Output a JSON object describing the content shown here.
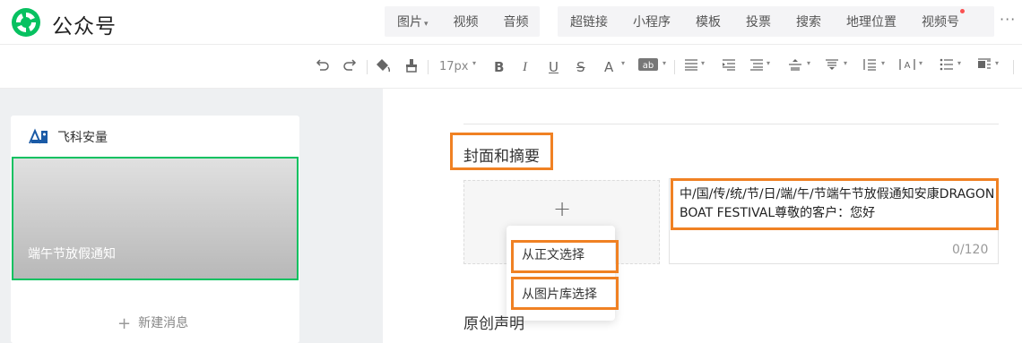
{
  "colors": {
    "brand_green": "#07c160",
    "highlight_orange": "#f08123"
  },
  "header": {
    "brand": "公众号",
    "insert_items": [
      {
        "label": "图片",
        "caret": "▾"
      },
      {
        "label": "视频"
      },
      {
        "label": "音频"
      },
      {
        "label": "超链接"
      },
      {
        "label": "小程序"
      },
      {
        "label": "模板"
      },
      {
        "label": "投票"
      },
      {
        "label": "搜索"
      },
      {
        "label": "地理位置"
      },
      {
        "label": "视频号"
      }
    ],
    "more": "···"
  },
  "toolbar": {
    "undo_icon": "undo-icon",
    "redo_icon": "redo-icon",
    "font_size": "17px",
    "bold": "B",
    "italic": "I",
    "underline": "U",
    "strike": "S",
    "font_color": "A"
  },
  "sidebar": {
    "account_name": "飞科安量",
    "article_title": "端午节放假通知",
    "new_message": "新建消息"
  },
  "editor": {
    "cover_section_title": "封面和摘要",
    "cover_menu": [
      "从正文选择",
      "从图片库选择"
    ],
    "summary": "中/国/传/统/节/日/端/午/节端午节放假通知安康DRAGON BOAT FESTIVAL尊敬的客户：您好",
    "counter": "0/120",
    "original_title": "原创声明"
  }
}
